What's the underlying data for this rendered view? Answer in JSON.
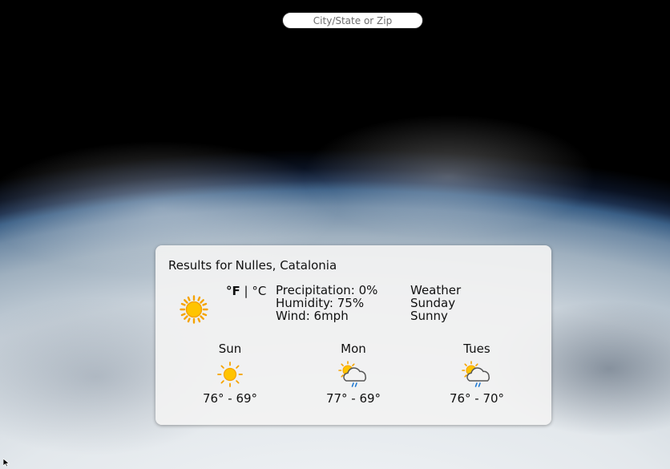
{
  "search": {
    "placeholder": "City/State or Zip"
  },
  "results": {
    "label": "Results for",
    "location": "Nulles, Catalonia"
  },
  "current": {
    "icon": "sun-icon",
    "unit_f": "°F",
    "separator": "|",
    "unit_c": "°C",
    "precipitation": "Precipitation: 0%",
    "humidity": "Humidity: 75%",
    "wind": "Wind: 6mph",
    "heading": "Weather",
    "day": "Sunday",
    "condition": "Sunny"
  },
  "forecast": [
    {
      "day": "Sun",
      "icon": "sun-icon",
      "range": "76° - 69°"
    },
    {
      "day": "Mon",
      "icon": "sun-cloud-rain-icon",
      "range": "77° - 69°"
    },
    {
      "day": "Tues",
      "icon": "sun-cloud-rain-icon",
      "range": "76° - 70°"
    }
  ],
  "colors": {
    "sun": "#ffc400",
    "sun_rays": "#f5a300",
    "cloud_outline": "#555555",
    "rain": "#1e78d2"
  }
}
